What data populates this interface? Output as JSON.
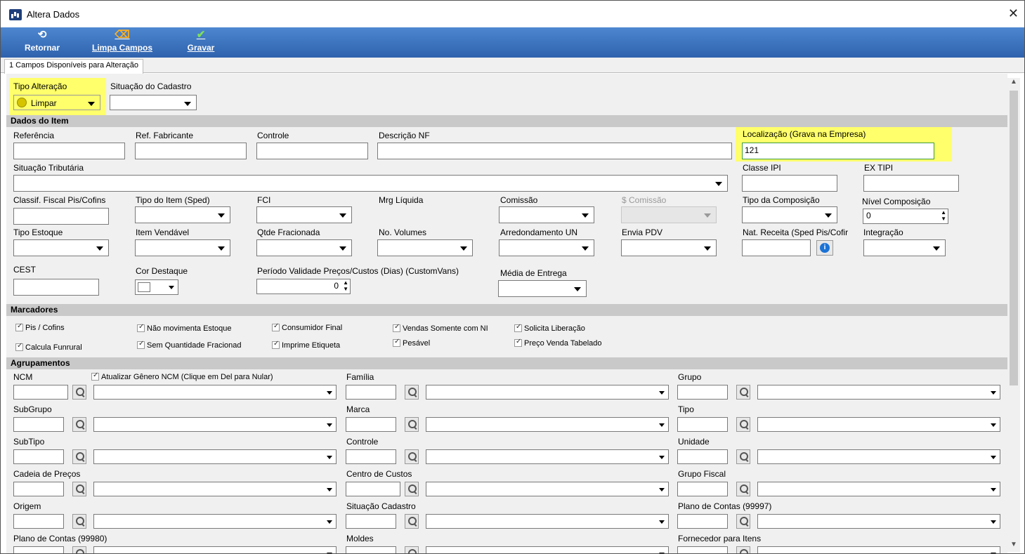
{
  "window": {
    "title": "Altera Dados",
    "close": "✕"
  },
  "toolbar": {
    "retornar": {
      "label": "Retornar",
      "icon": "⟲"
    },
    "limpa": {
      "label": "Limpa Campos",
      "icon": "⌫"
    },
    "gravar": {
      "label": "Gravar",
      "icon": "✔"
    }
  },
  "tab": {
    "label": "1 Campos Disponíveis para Alteração"
  },
  "top": {
    "tipo_alteracao_label": "Tipo Alteração",
    "tipo_alteracao_value": "Limpar",
    "situacao_label": "Situação do Cadastro"
  },
  "sections": {
    "dados": "Dados do Item",
    "marcadores": "Marcadores",
    "agrupamentos": "Agrupamentos"
  },
  "dados": {
    "referencia": "Referência",
    "ref_fabricante": "Ref. Fabricante",
    "controle": "Controle",
    "descricao_nf": "Descrição NF",
    "localizacao": "Localização (Grava na Empresa)",
    "localizacao_value": "121",
    "situacao_tributaria": "Situação Tributária",
    "classe_ipi": "Classe IPI",
    "ex_tipi": "EX TIPI",
    "classif_fiscal": "Classif. Fiscal Pis/Cofins",
    "tipo_item": "Tipo do Item (Sped)",
    "fci": "FCI",
    "mrg_liquida": "Mrg Líquida",
    "comissao": "Comissão",
    "s_comissao": "$ Comissão",
    "tipo_composicao": "Tipo da Composição",
    "nivel_composicao": "Nível Composição",
    "nivel_value": "0",
    "tipo_estoque": "Tipo Estoque",
    "item_vendavel": "Item Vendável",
    "qtde_fracionada": "Qtde Fracionada",
    "no_volumes": "No. Volumes",
    "arredondamento": "Arredondamento UN",
    "envia_pdv": "Envia PDV",
    "nat_receita": "Nat. Receita (Sped Pis/Cofir",
    "integracao": "Integração",
    "cest": "CEST",
    "cor_destaque": "Cor Destaque",
    "periodo_validade": "Período Validade Preços/Custos (Dias) (CustomVans)",
    "periodo_value": "0",
    "media_entrega": "Média de Entrega"
  },
  "marcadores": {
    "pis_cofins": "Pis / Cofins",
    "nao_movimenta": "Não movimenta Estoque",
    "consumidor_final": "Consumidor Final",
    "vendas_somente": "Vendas Somente com NI",
    "solicita_liberacao": "Solicita Liberação",
    "calcula_funrural": "Calcula Funrural",
    "sem_quantidade": "Sem Quantidade Fracionad",
    "imprime_etiqueta": "Imprime Etiqueta",
    "pesavel": "Pesável",
    "preco_venda": "Preço Venda Tabelado"
  },
  "agrup": {
    "ncm": "NCM",
    "atualizar_genero": "Atualizar Gênero NCM (Clique em Del para Nular)",
    "familia": "Família",
    "grupo": "Grupo",
    "subgrupo": "SubGrupo",
    "marca": "Marca",
    "tipo": "Tipo",
    "subtipo": "SubTipo",
    "controle": "Controle",
    "unidade": "Unidade",
    "cadeia": "Cadeia de Preços",
    "centro": "Centro de Custos",
    "grupo_fiscal": "Grupo Fiscal",
    "origem": "Origem",
    "situacao": "Situação Cadastro",
    "plano_97": "Plano de Contas (99997)",
    "plano_80": "Plano de Contas (99980)",
    "moldes": "Moldes",
    "fornecedor": "Fornecedor para Itens"
  },
  "colors": {
    "toolbar": "#3a71bd",
    "highlight": "#ffff6b",
    "section": "#c9c9c9"
  }
}
